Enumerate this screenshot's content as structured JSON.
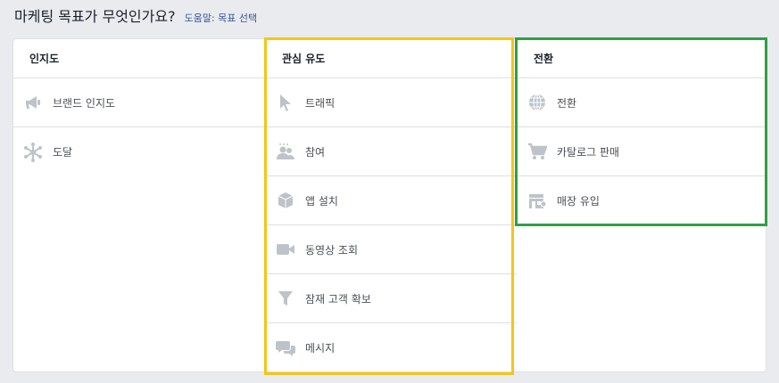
{
  "header": {
    "title": "마케팅 목표가 무엇인가요?",
    "help_link": "도움말: 목표 선택"
  },
  "columns": [
    {
      "heading": "인지도",
      "items": [
        {
          "label": "브랜드 인지도",
          "icon": "megaphone-icon"
        },
        {
          "label": "도달",
          "icon": "reach-icon"
        }
      ]
    },
    {
      "heading": "관심 유도",
      "items": [
        {
          "label": "트래픽",
          "icon": "cursor-icon"
        },
        {
          "label": "참여",
          "icon": "people-icon"
        },
        {
          "label": "앱 설치",
          "icon": "box-icon"
        },
        {
          "label": "동영상 조회",
          "icon": "video-camera-icon"
        },
        {
          "label": "잠재 고객 확보",
          "icon": "funnel-icon"
        },
        {
          "label": "메시지",
          "icon": "chat-bubbles-icon"
        }
      ]
    },
    {
      "heading": "전환",
      "items": [
        {
          "label": "전환",
          "icon": "globe-icon"
        },
        {
          "label": "카탈로그 판매",
          "icon": "cart-icon"
        },
        {
          "label": "매장 유입",
          "icon": "store-icon"
        }
      ]
    }
  ],
  "colors": {
    "highlight_yellow": "#f5c518",
    "highlight_green": "#2ea043",
    "link": "#365899",
    "icon": "#bec3c9"
  }
}
